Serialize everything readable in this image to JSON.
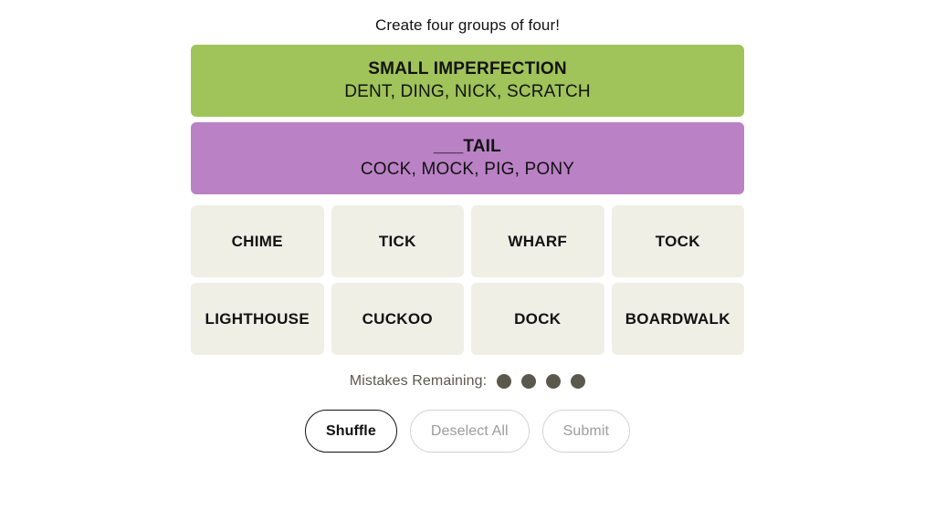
{
  "header": {
    "instruction": "Create four groups of four!"
  },
  "colors": {
    "page_background": "#ffffff",
    "tile_background": "#efefe6",
    "text": "#121212",
    "yellow": "#f9df6d",
    "green": "#a0c35a",
    "blue": "#b0c4ef",
    "purple": "#ba81c5",
    "dot": "#5a594e",
    "disabled_text": "#9c9c9c",
    "disabled_border": "#d3d3d3"
  },
  "solved_groups": [
    {
      "title": "SMALL IMPERFECTION",
      "members": "DENT, DING, NICK, SCRATCH",
      "color": "#a0c35a",
      "difficulty": "green"
    },
    {
      "title": "___TAIL",
      "members": "COCK, MOCK, PIG, PONY",
      "color": "#ba81c5",
      "difficulty": "purple"
    }
  ],
  "tile_rows": [
    [
      {
        "label": "CHIME",
        "selected": false
      },
      {
        "label": "TICK",
        "selected": false
      },
      {
        "label": "WHARF",
        "selected": false
      },
      {
        "label": "TOCK",
        "selected": false
      }
    ],
    [
      {
        "label": "LIGHTHOUSE",
        "selected": false
      },
      {
        "label": "CUCKOO",
        "selected": false
      },
      {
        "label": "DOCK",
        "selected": false
      },
      {
        "label": "BOARDWALK",
        "selected": false
      }
    ]
  ],
  "mistakes": {
    "label": "Mistakes Remaining:",
    "remaining": 4,
    "dots": [
      1,
      2,
      3,
      4
    ]
  },
  "controls": {
    "shuffle": {
      "label": "Shuffle",
      "enabled": true
    },
    "deselect_all": {
      "label": "Deselect All",
      "enabled": false
    },
    "submit": {
      "label": "Submit",
      "enabled": false
    }
  }
}
